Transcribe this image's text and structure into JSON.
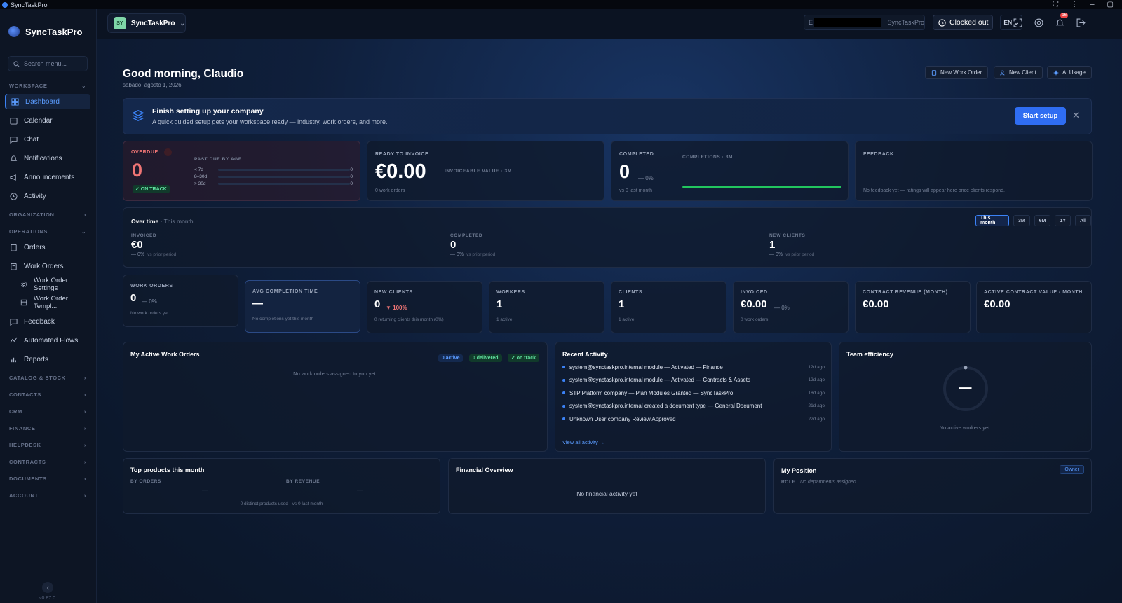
{
  "window": {
    "title": "SyncTaskPro",
    "controls": [
      "⛶",
      "⋮",
      "–",
      "▢"
    ]
  },
  "sidebar": {
    "brand": "SyncTaskPro",
    "search_placeholder": "Search menu...",
    "sections": {
      "workspace": "WORKSPACE",
      "organization": "ORGANIZATION",
      "operations": "OPERATIONS",
      "catalog": "CATALOG & STOCK",
      "contacts": "CONTACTS",
      "crm": "CRM",
      "finance": "FINANCE",
      "helpdesk": "HELPDESK",
      "contracts": "CONTRACTS",
      "documents": "DOCUMENTS",
      "account": "ACCOUNT"
    },
    "items": {
      "dashboard": "Dashboard",
      "calendar": "Calendar",
      "chat": "Chat",
      "notifications": "Notifications",
      "announcements": "Announcements",
      "activity": "Activity",
      "orders": "Orders",
      "work_orders": "Work Orders",
      "work_order_settings": "Work Order Settings",
      "work_order_templates": "Work Order Templ...",
      "feedback": "Feedback",
      "automated_flows": "Automated Flows",
      "reports": "Reports"
    },
    "version": "v0.87.0"
  },
  "topbar": {
    "org_initials": "SY",
    "org_name": "SyncTaskPro",
    "tenant_prefix": "E",
    "tenant_name": "SyncTaskPro",
    "clock_status": "Clocked out",
    "language": "EN",
    "notification_count": "16"
  },
  "header": {
    "greeting": "Good morning, Claudio",
    "date": "sábado, agosto 1, 2026",
    "new_work_order": "New Work Order",
    "new_client": "New Client",
    "ai_usage": "AI Usage"
  },
  "setup": {
    "title": "Finish setting up your company",
    "desc": "A quick guided setup gets your workspace ready — industry, work orders, and more.",
    "start": "Start setup"
  },
  "overdue": {
    "label": "OVERDUE",
    "alert": "!",
    "value": "0",
    "status": "✓ ON TRACK",
    "age_title": "PAST DUE BY AGE",
    "ages": [
      {
        "label": "< 7d",
        "value": "0",
        "fill": 0
      },
      {
        "label": "8–30d",
        "value": "0",
        "fill": 0
      },
      {
        "label": "> 30d",
        "value": "0",
        "fill": 0
      }
    ]
  },
  "ready_to_invoice": {
    "label": "READY TO INVOICE",
    "value": "€0.00",
    "sub": "INVOICEABLE VALUE · 3M",
    "count": "0 work orders"
  },
  "completed": {
    "label": "COMPLETED",
    "value": "0",
    "pct": "— 0%",
    "compare": "vs 0 last month",
    "chart_label": "COMPLETIONS · 3M",
    "line_color": "#22c55e"
  },
  "feedback": {
    "label": "FEEDBACK",
    "placeholder": "—",
    "note": "No feedback yet — ratings will appear here once clients respond."
  },
  "over_time": {
    "title": "Over time",
    "period": " · This month",
    "ranges": [
      "This month",
      "3M",
      "6M",
      "1Y",
      "All"
    ],
    "metrics": [
      {
        "label": "INVOICED",
        "value": "€0",
        "change": "— 0%",
        "suffix": "vs prior period"
      },
      {
        "label": "COMPLETED",
        "value": "0",
        "change": "— 0%",
        "suffix": "vs prior period"
      },
      {
        "label": "NEW CLIENTS",
        "value": "1",
        "change": "— 0%",
        "suffix": "vs prior period"
      }
    ]
  },
  "kpis": [
    {
      "label": "WORK ORDERS",
      "value": "0",
      "change": "— 0%",
      "sub": "No work orders yet"
    },
    {
      "label": "AVG COMPLETION TIME",
      "value": "—",
      "change": "",
      "sub": "No completions yet this month"
    },
    {
      "label": "NEW CLIENTS",
      "value": "0",
      "change": "▼ 100%",
      "sub": "0 returning clients this month (0%)"
    },
    {
      "label": "WORKERS",
      "value": "1",
      "change": "",
      "sub": "1 active"
    },
    {
      "label": "CLIENTS",
      "value": "1",
      "change": "",
      "sub": "1 active"
    },
    {
      "label": "INVOICED",
      "value": "€0.00",
      "change": "— 0%",
      "sub": "0 work orders"
    },
    {
      "label": "CONTRACT REVENUE (MONTH)",
      "value": "€0.00",
      "change": "",
      "sub": ""
    },
    {
      "label": "ACTIVE CONTRACT VALUE / MONTH",
      "value": "€0.00",
      "change": "",
      "sub": ""
    }
  ],
  "my_work_orders": {
    "title": "My Active Work Orders",
    "badges": [
      "0 active",
      "0 delivered",
      "✓ on track"
    ],
    "empty": "No work orders assigned to you yet."
  },
  "recent_activity": {
    "title": "Recent Activity",
    "items": [
      {
        "text": "system@synctaskpro.internal module — Activated — Finance",
        "ago": "12d ago"
      },
      {
        "text": "system@synctaskpro.internal module — Activated — Contracts & Assets",
        "ago": "12d ago"
      },
      {
        "text": "STP Platform company — Plan Modules Granted — SyncTaskPro",
        "ago": "18d ago"
      },
      {
        "text": "system@synctaskpro.internal created a document type — General Document",
        "ago": "21d ago"
      },
      {
        "text": "Unknown User company Review Approved",
        "ago": "22d ago"
      }
    ],
    "view_all": "View all activity →"
  },
  "team_efficiency": {
    "title": "Team efficiency",
    "value": "—",
    "empty": "No active workers yet."
  },
  "top_products": {
    "title": "Top products this month",
    "by_orders": "BY ORDERS",
    "by_revenue": "BY REVENUE",
    "orders_empty": "—",
    "revenue_empty": "—",
    "footer": "0 distinct products used · vs 0 last month"
  },
  "financial": {
    "title": "Financial Overview",
    "empty": "No financial activity yet"
  },
  "position": {
    "title": "My Position",
    "badge": "Owner",
    "role_label": "ROLE",
    "role_value": "No departments assigned"
  }
}
